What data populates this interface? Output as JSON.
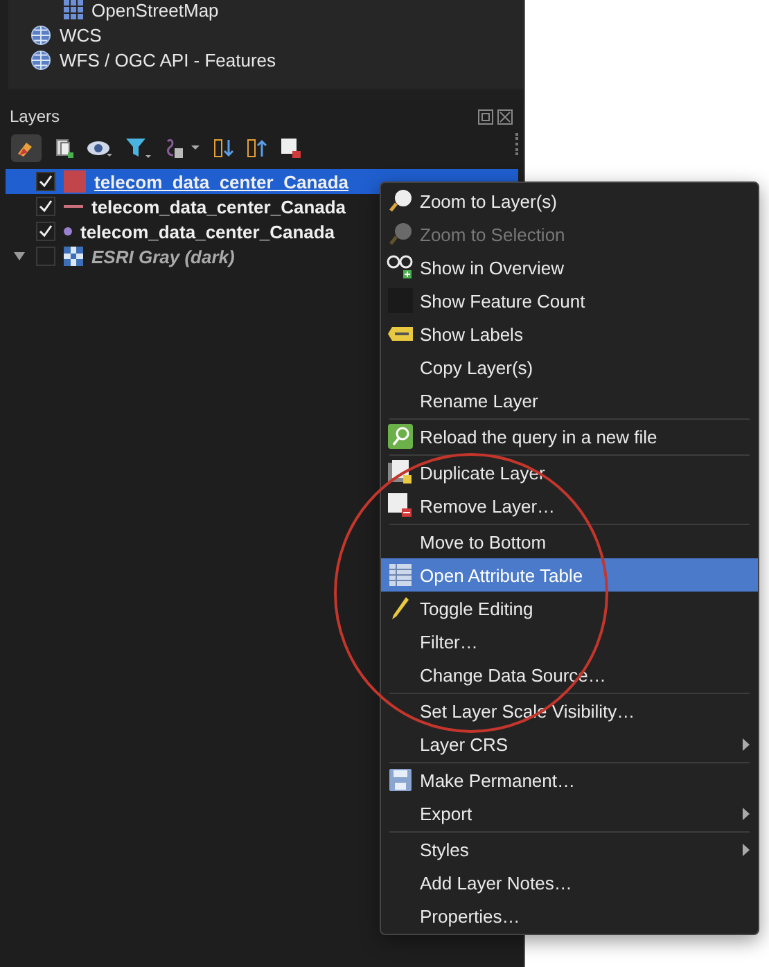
{
  "browser": {
    "items": [
      {
        "label": "OpenStreetMap",
        "kind": "tiles"
      },
      {
        "label": "WCS",
        "kind": "globe"
      },
      {
        "label": "WFS / OGC API - Features",
        "kind": "globe"
      }
    ]
  },
  "layers_panel": {
    "title": "Layers",
    "layers": [
      {
        "name": "telecom_data_center_Canada",
        "kind": "fill",
        "checked": true,
        "selected": true,
        "expanded": false
      },
      {
        "name": "telecom_data_center_Canada",
        "kind": "line",
        "checked": true,
        "selected": false,
        "expanded": false
      },
      {
        "name": "telecom_data_center_Canada",
        "kind": "point",
        "checked": true,
        "selected": false,
        "expanded": false
      },
      {
        "name": "ESRI Gray (dark)",
        "kind": "raster",
        "checked": false,
        "selected": false,
        "expanded": true
      }
    ]
  },
  "context_menu": {
    "items": [
      {
        "kind": "item",
        "label": "Zoom to Layer(s)",
        "disabled": false,
        "selected": false
      },
      {
        "kind": "item",
        "label": "Zoom to Selection",
        "disabled": true,
        "selected": false
      },
      {
        "kind": "item",
        "label": "Show in Overview",
        "disabled": false,
        "selected": false
      },
      {
        "kind": "item",
        "label": "Show Feature Count",
        "disabled": false,
        "selected": false
      },
      {
        "kind": "item",
        "label": "Show Labels",
        "disabled": false,
        "selected": false
      },
      {
        "kind": "item",
        "label": "Copy Layer(s)",
        "disabled": false,
        "selected": false
      },
      {
        "kind": "item",
        "label": "Rename Layer",
        "disabled": false,
        "selected": false
      },
      {
        "kind": "separator"
      },
      {
        "kind": "item",
        "label": "Reload the query in a new file",
        "disabled": false,
        "selected": false
      },
      {
        "kind": "separator"
      },
      {
        "kind": "item",
        "label": "Duplicate Layer",
        "disabled": false,
        "selected": false
      },
      {
        "kind": "item",
        "label": "Remove Layer…",
        "disabled": false,
        "selected": false
      },
      {
        "kind": "separator"
      },
      {
        "kind": "item",
        "label": "Move to Bottom",
        "disabled": false,
        "selected": false
      },
      {
        "kind": "item",
        "label": "Open Attribute Table",
        "disabled": false,
        "selected": true
      },
      {
        "kind": "item",
        "label": "Toggle Editing",
        "disabled": false,
        "selected": false
      },
      {
        "kind": "item",
        "label": "Filter…",
        "disabled": false,
        "selected": false
      },
      {
        "kind": "item",
        "label": "Change Data Source…",
        "disabled": false,
        "selected": false
      },
      {
        "kind": "separator"
      },
      {
        "kind": "item",
        "label": "Set Layer Scale Visibility…",
        "disabled": false,
        "selected": false
      },
      {
        "kind": "item",
        "label": "Layer CRS",
        "disabled": false,
        "selected": false,
        "submenu": true
      },
      {
        "kind": "separator"
      },
      {
        "kind": "item",
        "label": "Make Permanent…",
        "disabled": false,
        "selected": false
      },
      {
        "kind": "item",
        "label": "Export",
        "disabled": false,
        "selected": false,
        "submenu": true
      },
      {
        "kind": "separator"
      },
      {
        "kind": "item",
        "label": "Styles",
        "disabled": false,
        "selected": false,
        "submenu": true
      },
      {
        "kind": "item",
        "label": "Add Layer Notes…",
        "disabled": false,
        "selected": false
      },
      {
        "kind": "item",
        "label": "Properties…",
        "disabled": false,
        "selected": false
      }
    ]
  }
}
